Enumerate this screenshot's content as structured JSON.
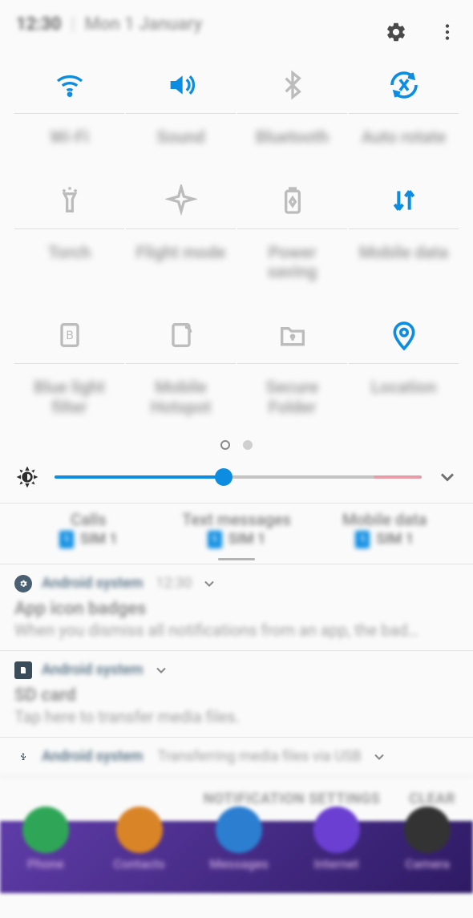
{
  "status": {
    "time": "12:30",
    "date": "Mon 1 January"
  },
  "qs": [
    {
      "key": "wifi",
      "label": "Wi-Fi",
      "active": true
    },
    {
      "key": "sound",
      "label": "Sound",
      "active": true
    },
    {
      "key": "bluetooth",
      "label": "Bluetooth",
      "active": false
    },
    {
      "key": "autorotate",
      "label": "Auto rotate",
      "active": true
    },
    {
      "key": "torch",
      "label": "Torch",
      "active": false
    },
    {
      "key": "flight",
      "label": "Flight mode",
      "active": false
    },
    {
      "key": "power",
      "label": "Power saving",
      "active": false
    },
    {
      "key": "mobiledata",
      "label": "Mobile data",
      "active": true
    },
    {
      "key": "bluelight",
      "label": "Blue light filter",
      "active": false
    },
    {
      "key": "hotspot",
      "label": "Mobile Hotspot",
      "active": false
    },
    {
      "key": "secure",
      "label": "Secure Folder",
      "active": false
    },
    {
      "key": "location",
      "label": "Location",
      "active": true
    }
  ],
  "brightness": {
    "percent": 46
  },
  "sim": {
    "cols": [
      {
        "title": "Calls",
        "badge": "1",
        "value": "SIM 1"
      },
      {
        "title": "Text messages",
        "badge": "1",
        "value": "SIM 1"
      },
      {
        "title": "Mobile data",
        "badge": "1",
        "value": "SIM 1"
      }
    ]
  },
  "notifs": [
    {
      "icon": "gear",
      "app": "Android system",
      "meta": "12:30",
      "title": "App icon badges",
      "text": "When you dismiss all notifications from an app, the bad…"
    },
    {
      "icon": "sd",
      "app": "Android system",
      "title": "SD card",
      "text": "Tap here to transfer media files."
    },
    {
      "icon": "usb",
      "app": "Android system",
      "inline": "Transferring media files via USB"
    }
  ],
  "footer": {
    "settings": "NOTIFICATION SETTINGS",
    "clear": "CLEAR"
  },
  "dock": [
    {
      "label": "Phone",
      "color": "#2fa657"
    },
    {
      "label": "Contacts",
      "color": "#d98427"
    },
    {
      "label": "Messages",
      "color": "#2c7ed1"
    },
    {
      "label": "Internet",
      "color": "#6a3fd1"
    },
    {
      "label": "Camera",
      "color": "#333333"
    }
  ]
}
